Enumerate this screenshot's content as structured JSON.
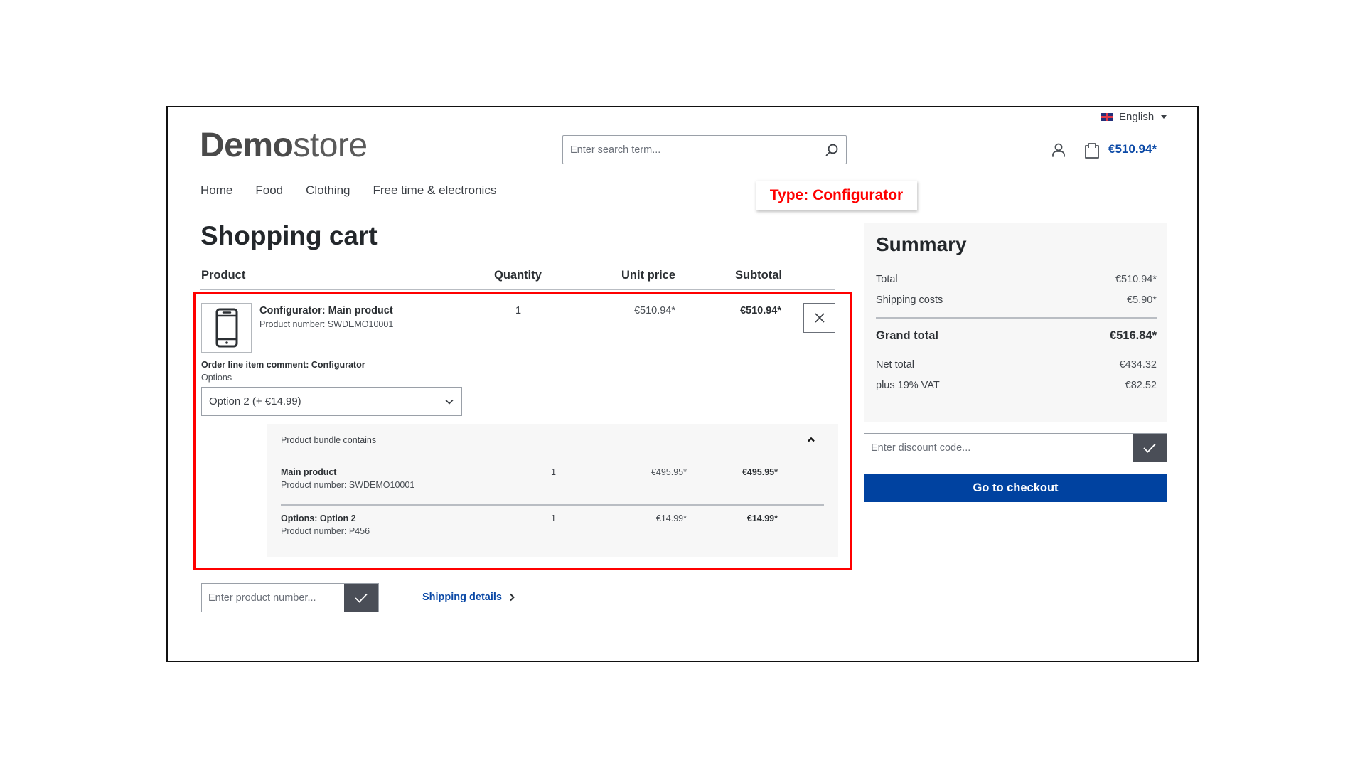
{
  "header": {
    "logo_bold": "Demo",
    "logo_light": "store",
    "language": "English",
    "language_flag": "uk-flag-icon",
    "search_placeholder": "Enter search term...",
    "cart_total": "€510.94*"
  },
  "nav": {
    "items": [
      {
        "label": "Home"
      },
      {
        "label": "Food"
      },
      {
        "label": "Clothing"
      },
      {
        "label": "Free time & electronics"
      }
    ]
  },
  "annotation": {
    "label": "Type: Configurator",
    "color": "#ff0000"
  },
  "cart": {
    "title": "Shopping cart",
    "columns": {
      "product": "Product",
      "quantity": "Quantity",
      "unit_price": "Unit price",
      "subtotal": "Subtotal"
    },
    "line_item": {
      "name": "Configurator: Main product",
      "product_number": "Product number: SWDEMO10001",
      "quantity": "1",
      "unit_price": "€510.94*",
      "subtotal": "€510.94*",
      "image_icon": "smartphone-icon",
      "comment": "Order line item comment: Configurator",
      "options_label": "Options",
      "options_selected": "Option 2 (+ €14.99)"
    },
    "bundle": {
      "title": "Product bundle contains",
      "items": [
        {
          "name": "Main product",
          "product_number": "Product number: SWDEMO10001",
          "quantity": "1",
          "unit_price": "€495.95*",
          "subtotal": "€495.95*"
        },
        {
          "name": "Options: Option 2",
          "product_number": "Product number: P456",
          "quantity": "1",
          "unit_price": "€14.99*",
          "subtotal": "€14.99*"
        }
      ]
    },
    "product_number_placeholder": "Enter product number...",
    "shipping_details_link": "Shipping details"
  },
  "summary": {
    "title": "Summary",
    "total_label": "Total",
    "total_value": "€510.94*",
    "shipping_label": "Shipping costs",
    "shipping_value": "€5.90*",
    "grand_total_label": "Grand total",
    "grand_total_value": "€516.84*",
    "net_total_label": "Net total",
    "net_total_value": "€434.32",
    "vat_label": "plus 19% VAT",
    "vat_value": "€82.52",
    "discount_placeholder": "Enter discount code...",
    "checkout_label": "Go to checkout"
  },
  "colors": {
    "brand_blue": "#0042a0",
    "link_blue": "#0b49a6",
    "dark_button": "#4a4e57",
    "highlight_red": "#ff0000"
  }
}
